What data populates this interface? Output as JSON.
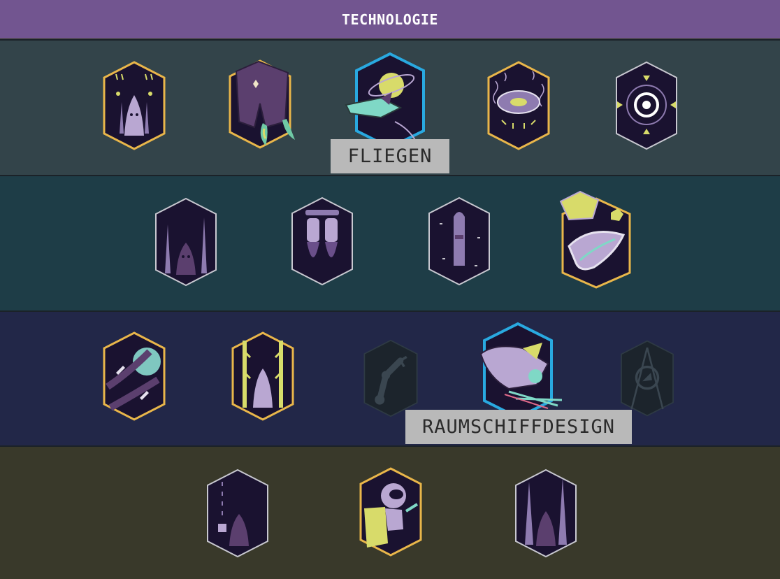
{
  "header": {
    "title": "TECHNOLOGIE"
  },
  "tooltips": {
    "fliegen": "FLIEGEN",
    "raumschiffdesign": "RAUMSCHIFFDESIGN"
  },
  "colors": {
    "header_bg": "#725590",
    "row1_bg": "#33444a",
    "row2_bg": "#1e3d47",
    "row3_bg": "#222748",
    "row4_bg": "#39392a",
    "badge_fill": "#1a1230",
    "border_gold": "#e9b64a",
    "border_silver": "#c8c8d0",
    "border_selected": "#29a9e0",
    "tooltip_bg": "#b9b9b9",
    "tooltip_text": "#2b2b2b"
  },
  "rows": [
    {
      "badges": [
        {
          "icon": "rocket-fleet-icon",
          "state": "unlocked"
        },
        {
          "icon": "jetpack-icon",
          "state": "unlocked"
        },
        {
          "icon": "shuttle-orbit-icon",
          "state": "selected"
        },
        {
          "icon": "circuit-disc-icon",
          "state": "unlocked"
        },
        {
          "icon": "target-ring-icon",
          "state": "available"
        }
      ]
    },
    {
      "badges": [
        {
          "icon": "twin-spire-icon",
          "state": "available"
        },
        {
          "icon": "thruster-pair-icon",
          "state": "available"
        },
        {
          "icon": "capsule-icon",
          "state": "available"
        },
        {
          "icon": "asteroid-catcher-icon",
          "state": "unlocked"
        }
      ]
    },
    {
      "badges": [
        {
          "icon": "planet-rockets-icon",
          "state": "unlocked"
        },
        {
          "icon": "launch-tower-icon",
          "state": "unlocked"
        },
        {
          "icon": "robot-arm-icon",
          "state": "locked"
        },
        {
          "icon": "shuttle-laser-icon",
          "state": "selected"
        },
        {
          "icon": "compass-ship-icon",
          "state": "locked"
        }
      ]
    },
    {
      "badges": [
        {
          "icon": "rocket-trail-icon",
          "state": "available"
        },
        {
          "icon": "astronaut-icon",
          "state": "unlocked"
        },
        {
          "icon": "spire-rocket-icon",
          "state": "available"
        }
      ]
    }
  ]
}
